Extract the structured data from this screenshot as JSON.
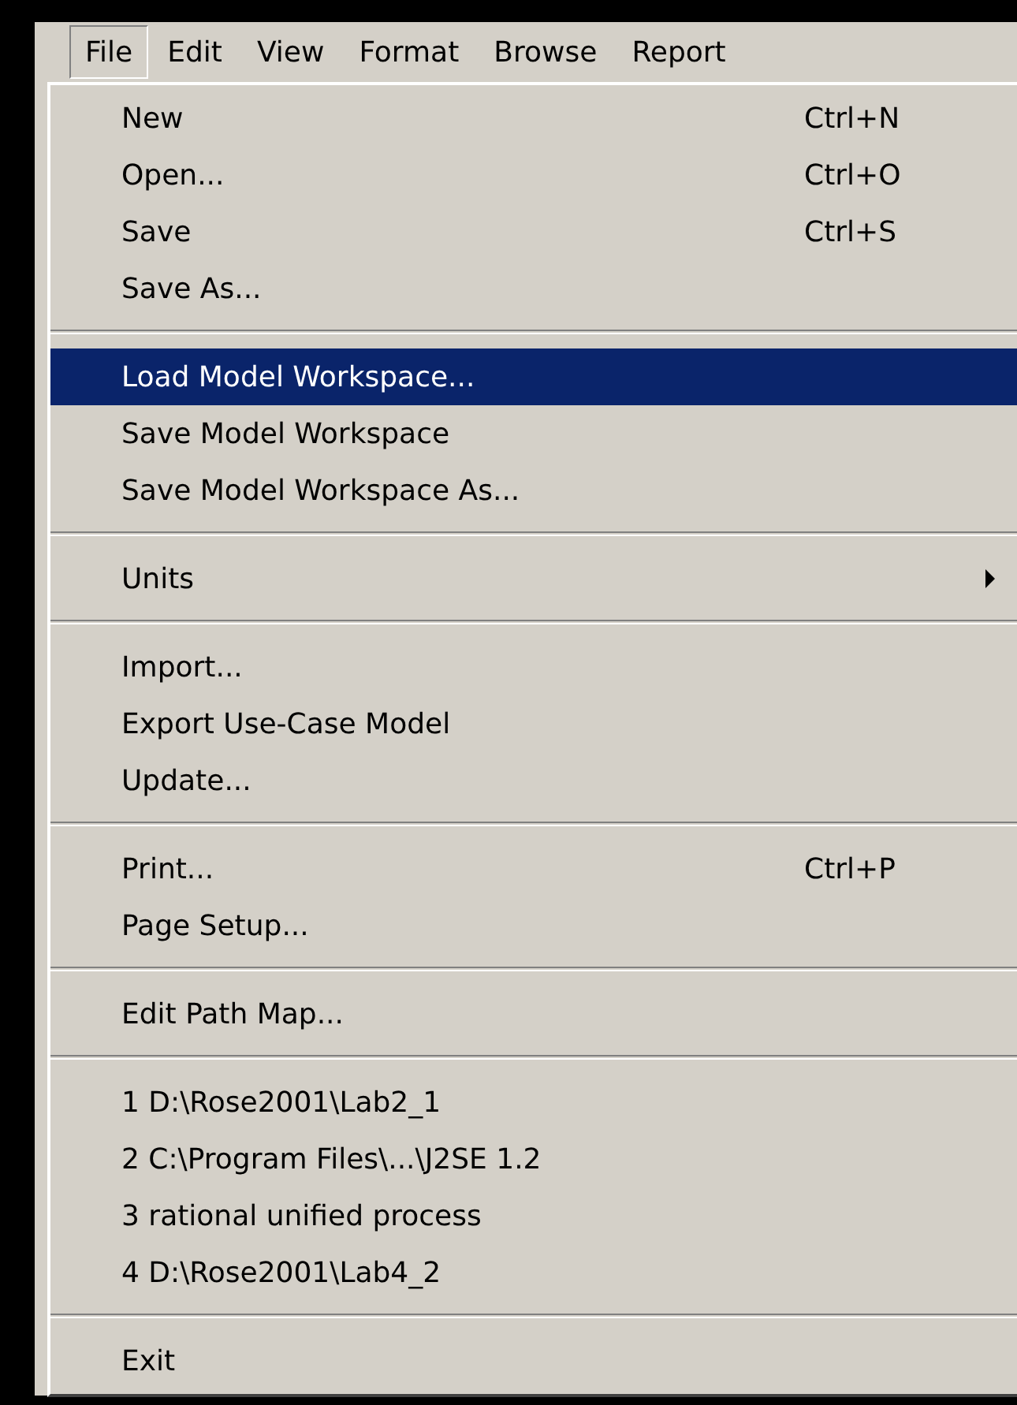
{
  "menubar": [
    {
      "label": "File",
      "selected": true
    },
    {
      "label": "Edit",
      "selected": false
    },
    {
      "label": "View",
      "selected": false
    },
    {
      "label": "Format",
      "selected": false
    },
    {
      "label": "Browse",
      "selected": false
    },
    {
      "label": "Report",
      "selected": false
    }
  ],
  "menu": [
    {
      "kind": "item",
      "label": "New",
      "shortcut": "Ctrl+N",
      "selected": false
    },
    {
      "kind": "item",
      "label": "Open...",
      "shortcut": "Ctrl+O",
      "selected": false
    },
    {
      "kind": "item",
      "label": "Save",
      "shortcut": "Ctrl+S",
      "selected": false
    },
    {
      "kind": "item",
      "label": "Save As...",
      "selected": false
    },
    {
      "kind": "separator"
    },
    {
      "kind": "item",
      "label": "Load Model Workspace...",
      "selected": true
    },
    {
      "kind": "item",
      "label": "Save Model Workspace",
      "selected": false
    },
    {
      "kind": "item",
      "label": "Save Model Workspace As...",
      "selected": false
    },
    {
      "kind": "separator"
    },
    {
      "kind": "submenu",
      "label": "Units",
      "selected": false
    },
    {
      "kind": "separator"
    },
    {
      "kind": "item",
      "label": "Import...",
      "selected": false
    },
    {
      "kind": "item",
      "label": "Export Use-Case Model",
      "selected": false
    },
    {
      "kind": "item",
      "label": "Update...",
      "selected": false
    },
    {
      "kind": "separator"
    },
    {
      "kind": "item",
      "label": "Print...",
      "shortcut": "Ctrl+P",
      "selected": false
    },
    {
      "kind": "item",
      "label": "Page Setup...",
      "selected": false
    },
    {
      "kind": "separator"
    },
    {
      "kind": "item",
      "label": "Edit Path Map...",
      "selected": false
    },
    {
      "kind": "separator"
    },
    {
      "kind": "item",
      "label": "1 D:\\Rose2001\\Lab2_1",
      "selected": false
    },
    {
      "kind": "item",
      "label": "2 C:\\Program Files\\...\\J2SE 1.2",
      "selected": false
    },
    {
      "kind": "item",
      "label": "3 rational unified process",
      "selected": false
    },
    {
      "kind": "item",
      "label": "4 D:\\Rose2001\\Lab4_2",
      "selected": false
    },
    {
      "kind": "separator"
    },
    {
      "kind": "item",
      "label": "Exit",
      "selected": false
    }
  ]
}
